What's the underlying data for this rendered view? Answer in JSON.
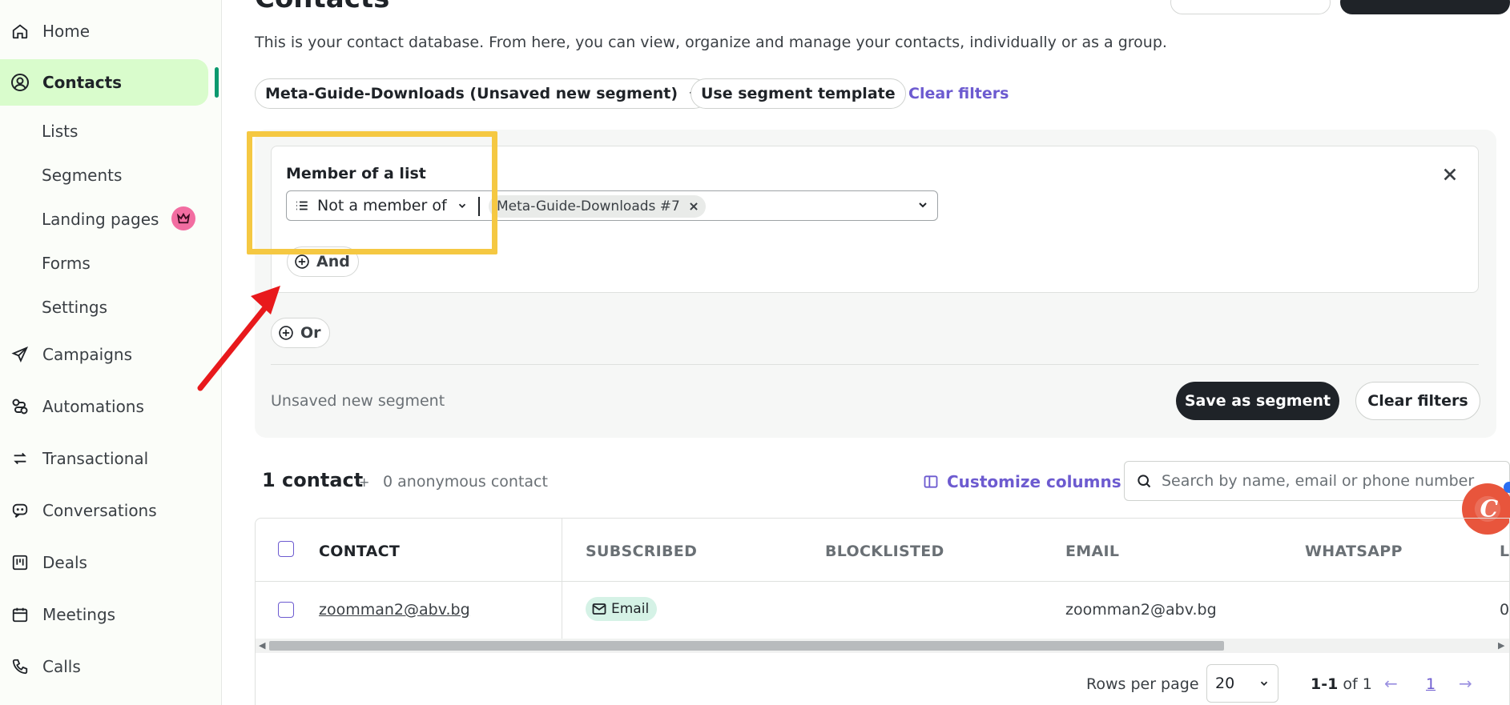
{
  "sidebar": {
    "home": "Home",
    "contacts": "Contacts",
    "sub_items": [
      "Lists",
      "Segments",
      "Landing pages",
      "Forms",
      "Settings"
    ],
    "campaigns": "Campaigns",
    "automations": "Automations",
    "transactional": "Transactional",
    "conversations": "Conversations",
    "deals": "Deals",
    "meetings": "Meetings",
    "calls": "Calls"
  },
  "page": {
    "title": "Contacts",
    "description": "This is your contact database. From here, you can view, organize and manage your contacts, individually or as a group."
  },
  "segment_bar": {
    "segment_select": "Meta-Guide-Downloads (Unsaved new segment)",
    "template_button": "Use segment template",
    "clear_link": "Clear filters"
  },
  "condition": {
    "label": "Member of a list",
    "operator": "Not a member of",
    "chip": "Meta-Guide-Downloads #7",
    "and_button": "And",
    "or_button": "Or"
  },
  "segment_footer": {
    "status": "Unsaved new segment",
    "save_button": "Save as segment",
    "clear_button": "Clear filters"
  },
  "contacts_summary": {
    "count": "1 contact",
    "plus": "+",
    "anonymous": "0 anonymous contact",
    "customize": "Customize columns",
    "search_placeholder": "Search by name, email or phone number"
  },
  "table": {
    "headers": [
      "CONTACT",
      "SUBSCRIBED",
      "BLOCKLISTED",
      "EMAIL",
      "WHATSAPP",
      "L"
    ],
    "rows": [
      {
        "contact": "zoomman2@abv.bg",
        "subscribed": "Email",
        "email": "zoomman2@abv.bg",
        "overflow": "0"
      }
    ]
  },
  "pagination": {
    "rows_label": "Rows per page",
    "rows_value": "20",
    "range_bold": "1-1",
    "range_rest": "of 1",
    "page": "1"
  },
  "colors": {
    "accent": "#6d5bd0",
    "active_nav": "#d9fccc",
    "highlight": "#f5c842",
    "arrow": "#e8191c"
  }
}
